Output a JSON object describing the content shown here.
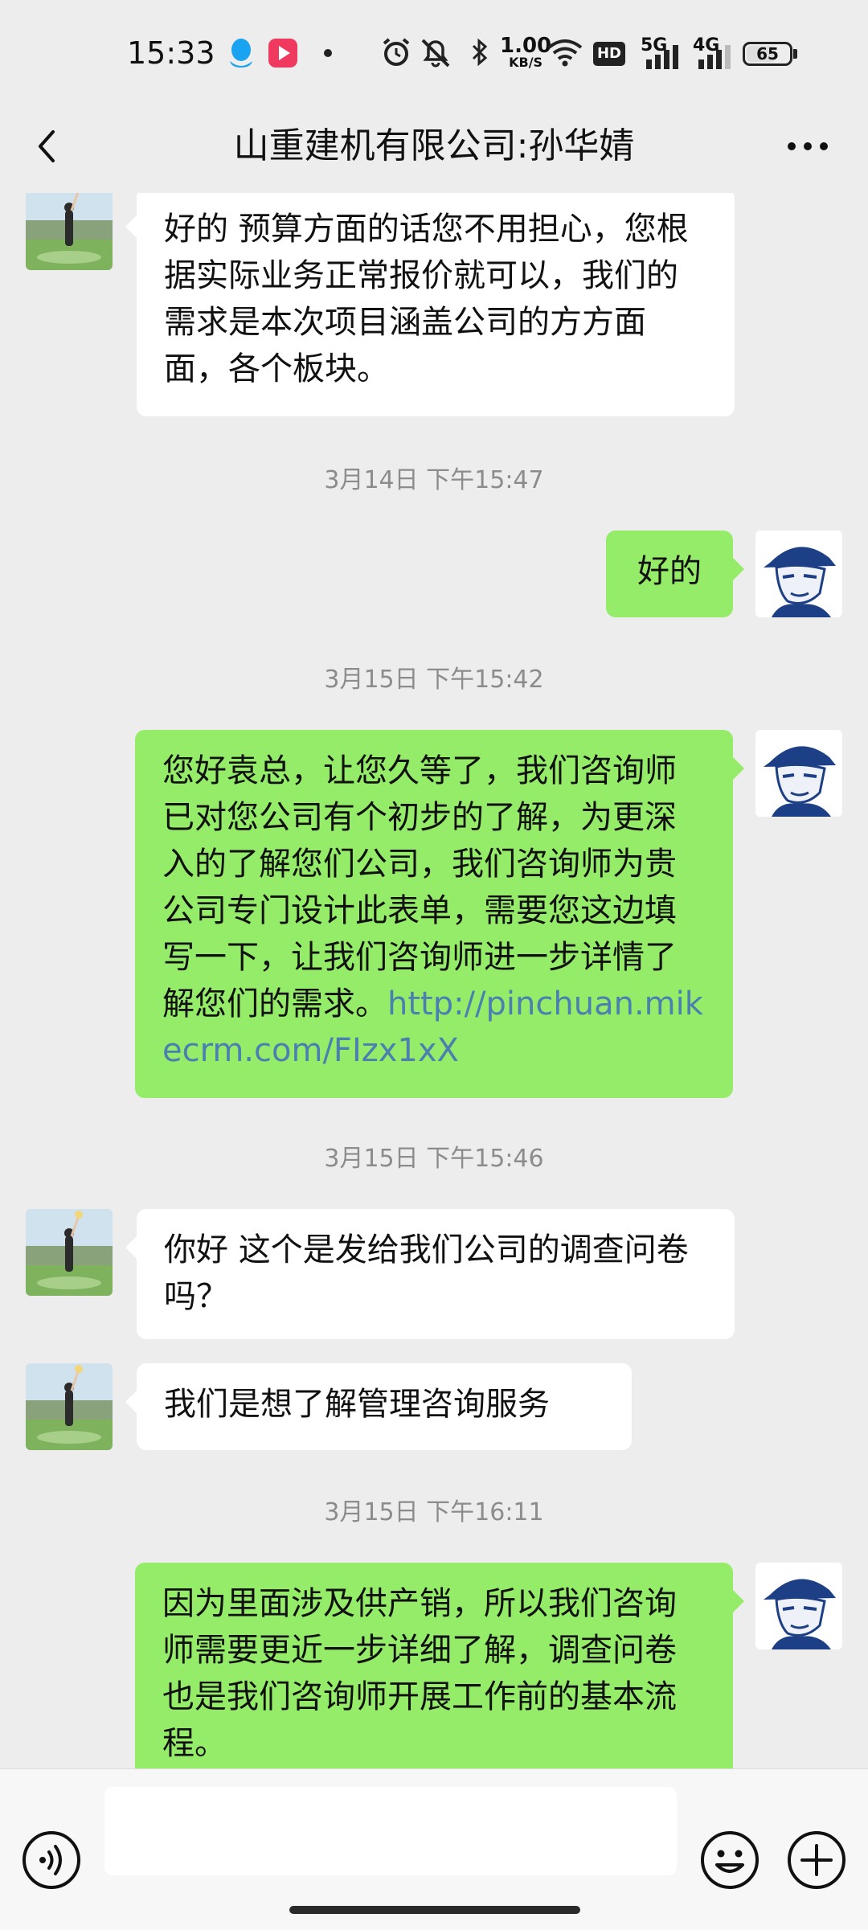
{
  "status_bar": {
    "time": "15:33",
    "speed_value": "1.00",
    "speed_unit": "KB/S",
    "hd_label": "HD",
    "net_5g": "5G",
    "net_4g": "4G",
    "battery": "65",
    "battery_level": 0.65
  },
  "header": {
    "title": "山重建机有限公司:孙华婧"
  },
  "chat": {
    "messages": [
      {
        "side": "in",
        "text": "好的  预算方面的话您不用担心，您根据实际业务正常报价就可以，我们的需求是本次项目涵盖公司的方方面面，各个板块。"
      },
      {
        "timestamp": "3月14日 下午15:47"
      },
      {
        "side": "out",
        "text": "好的"
      },
      {
        "timestamp": "3月15日 下午15:42"
      },
      {
        "side": "out",
        "text": "您好袁总，让您久等了，我们咨询师已对您公司有个初步的了解，为更深入的了解您们公司，我们咨询师为贵公司专门设计此表单，需要您这边填写一下，让我们咨询师进一步详情了解您们的需求。",
        "link": "http://pinchuan.mikecrm.com/FIzx1xX"
      },
      {
        "timestamp": "3月15日 下午15:46"
      },
      {
        "side": "in",
        "text": "你好 这个是发给我们公司的调查问卷吗？"
      },
      {
        "side": "in",
        "text": "我们是想了解管理咨询服务"
      },
      {
        "timestamp": "3月15日 下午16:11"
      },
      {
        "side": "out",
        "text": "因为里面涉及供产销，所以我们咨询师需要更近一步详细了解，调查问卷也是我们咨询师开展工作前的基本流程。"
      }
    ]
  },
  "icons": {
    "back": "chevron-left-icon",
    "more": "more-dots-icon",
    "voice": "voice-icon",
    "emoji": "emoji-icon",
    "plus": "plus-icon"
  },
  "colors": {
    "outgoing_bubble": "#95ec69",
    "incoming_bubble": "#ffffff",
    "link": "#4a7fb0",
    "background": "#ededed"
  }
}
